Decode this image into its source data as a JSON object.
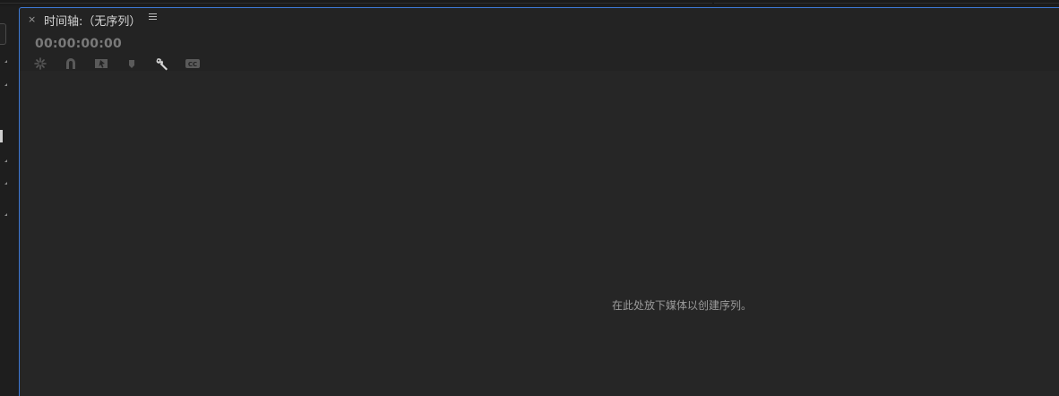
{
  "panel": {
    "close_label": "×",
    "title": "时间轴:（无序列）",
    "menu_icon": "hamburger-menu-icon"
  },
  "timecode": "00:00:00:00",
  "toolbar": {
    "icons": [
      "nest-sequence-icon",
      "snap-magnet-icon",
      "linked-selection-icon",
      "add-marker-icon",
      "timeline-settings-wrench-icon",
      "captions-cc-icon"
    ]
  },
  "canvas": {
    "drop_hint": "在此处放下媒体以创建序列。"
  },
  "colors": {
    "panel_border_active": "#3e7ad6",
    "panel_background": "#232323",
    "canvas_background": "#262626",
    "timecode_text": "#7a7a7a"
  }
}
